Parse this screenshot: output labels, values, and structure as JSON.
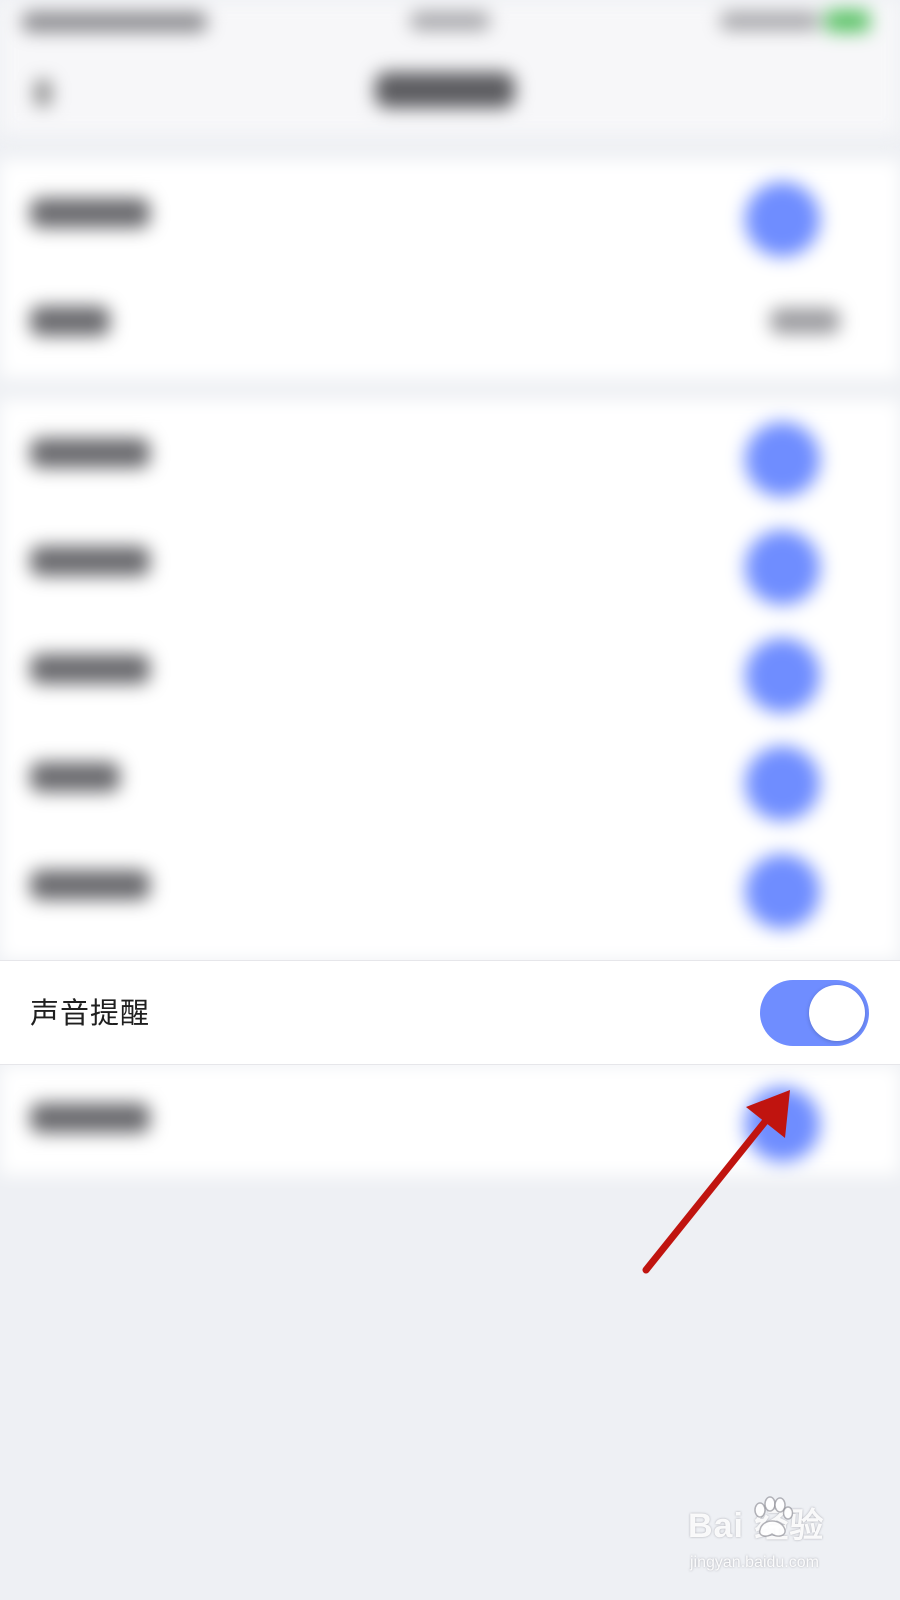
{
  "screen": {
    "focus_setting": {
      "label": "声音提醒",
      "toggle_on": true
    }
  },
  "blurred_settings": {
    "group_1_rows": [
      "toggle",
      "value"
    ],
    "group_2_rows": [
      "toggle",
      "toggle",
      "toggle",
      "toggle",
      "toggle"
    ],
    "group_3_rows": [
      "toggle"
    ]
  },
  "watermark": {
    "main": "Bai  经验",
    "sub": "jingyan.baidu.com"
  },
  "colors": {
    "accent": "#6f8dff",
    "background": "#eef0f4",
    "annotation_arrow": "#c0140f"
  }
}
